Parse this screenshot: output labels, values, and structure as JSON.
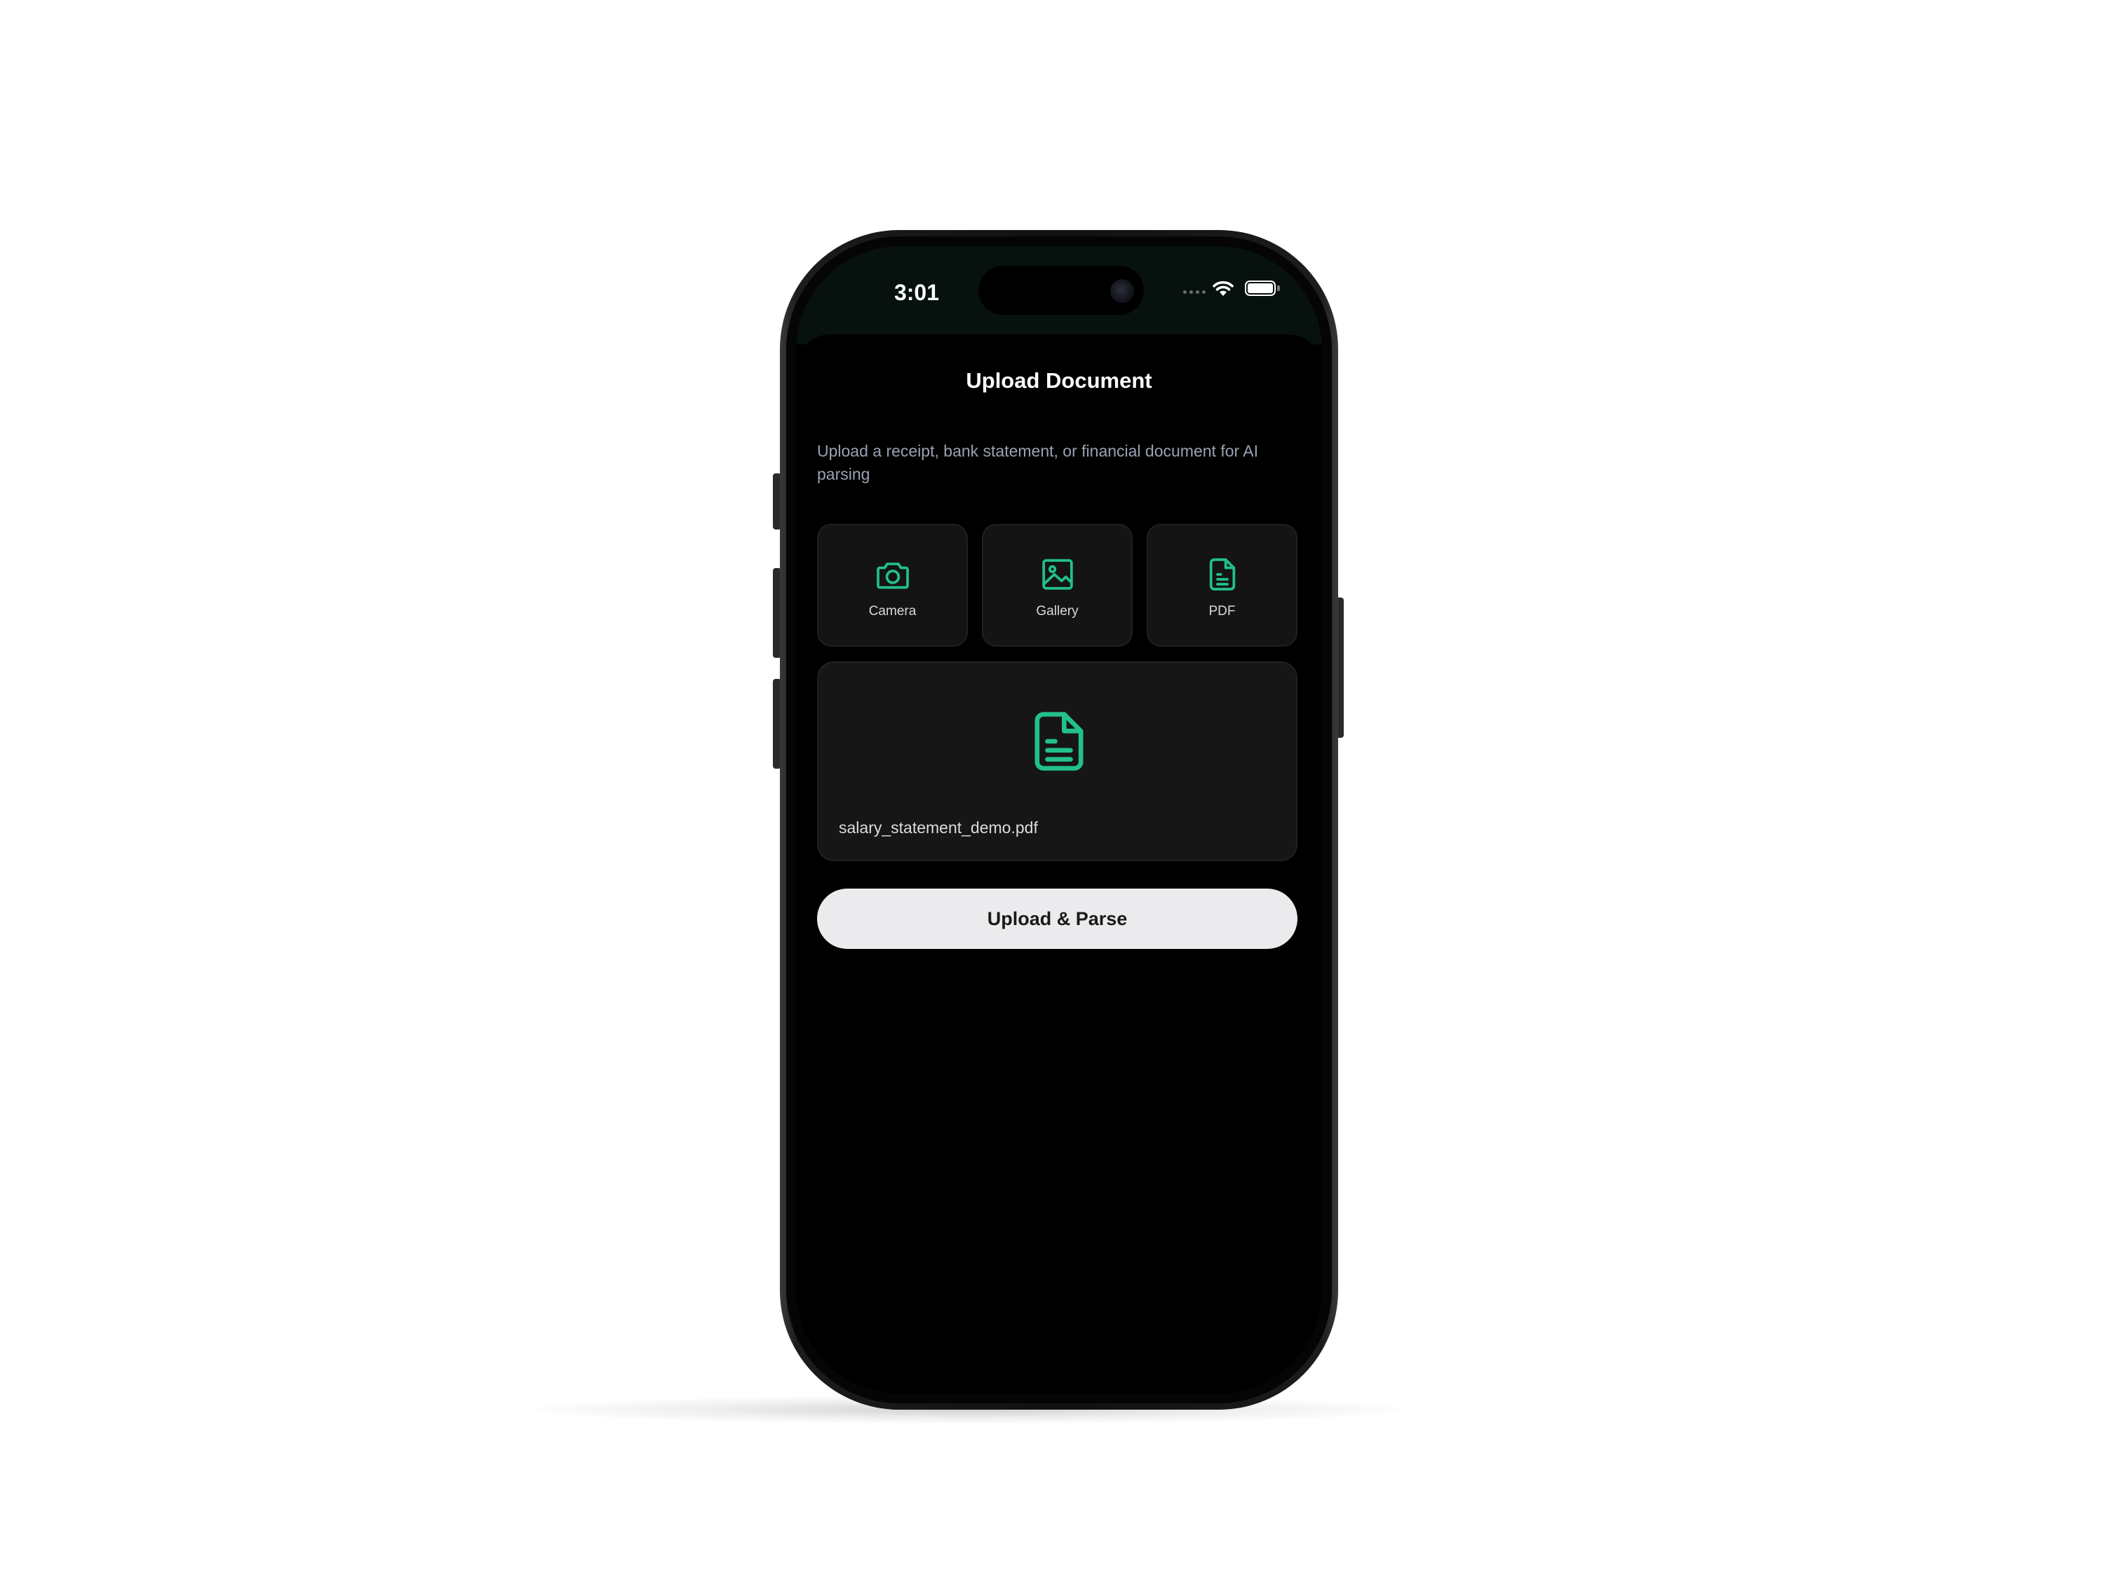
{
  "status_bar": {
    "time": "3:01",
    "icons": [
      "signal-icon",
      "wifi-icon",
      "battery-icon"
    ]
  },
  "header": {
    "title": "Upload Document"
  },
  "description": "Upload a receipt, bank statement, or financial document for AI parsing",
  "sources": [
    {
      "label": "Camera",
      "icon": "camera-icon"
    },
    {
      "label": "Gallery",
      "icon": "image-icon"
    },
    {
      "label": "PDF",
      "icon": "document-icon"
    }
  ],
  "preview": {
    "icon": "document-icon",
    "filename": "salary_statement_demo.pdf"
  },
  "actions": {
    "upload_label": "Upload & Parse"
  },
  "colors": {
    "accent": "#22c08a",
    "background": "#000000",
    "card": "#161616",
    "button": "#ebebee"
  }
}
